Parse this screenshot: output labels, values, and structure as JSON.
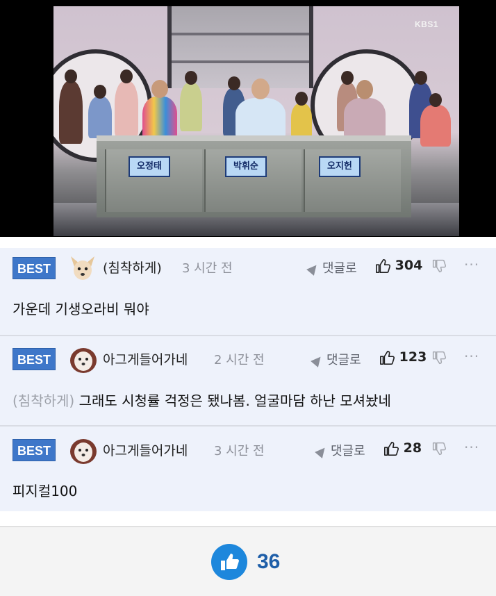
{
  "video": {
    "channel_logo": "KBS1",
    "nameplates": [
      "오정태",
      "박휘순",
      "오지헌"
    ]
  },
  "comments": [
    {
      "badge": "BEST",
      "author": "(침착하게)",
      "time": "3 시간 전",
      "reply_label": "댓글로",
      "likes": "304",
      "text": "가운데 기생오라비 뭐야",
      "more": "···"
    },
    {
      "badge": "BEST",
      "author": "아그게들어가네",
      "time": "2 시간 전",
      "reply_label": "댓글로",
      "likes": "123",
      "mention": "(침착하게)",
      "text": "그래도 시청률 걱정은 됐나봄. 얼굴마담 하난 모셔놨네",
      "more": "···"
    },
    {
      "badge": "BEST",
      "author": "아그게들어가네",
      "time": "3 시간 전",
      "reply_label": "댓글로",
      "likes": "28",
      "text": "피지컬100",
      "more": "···"
    }
  ],
  "post_like": {
    "count": "36",
    "accent": "#1d87dc"
  }
}
